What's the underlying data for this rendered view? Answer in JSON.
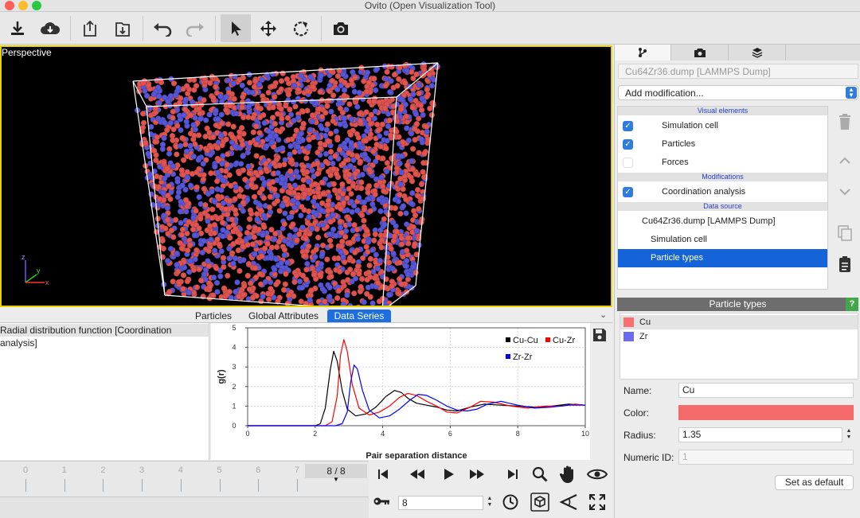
{
  "window": {
    "title": "Ovito (Open Visualization Tool)"
  },
  "toolbar": {
    "buttons": [
      "load-file-icon",
      "load-remote-icon",
      "export-icon",
      "export-image-icon",
      "undo-icon",
      "redo-icon",
      "select-mode-icon",
      "pan-icon",
      "orbit-icon",
      "render-icon"
    ]
  },
  "viewport": {
    "caption": "Perspective",
    "axes": {
      "z": "z",
      "y": "y",
      "x": "x"
    }
  },
  "pipeline": {
    "source_title": "Cu64Zr36.dump [LAMMPS Dump]",
    "add_modification": "Add modification...",
    "section_visual": "Visual elements",
    "visual_items": [
      {
        "label": "Simulation cell",
        "checked": true
      },
      {
        "label": "Particles",
        "checked": true
      },
      {
        "label": "Forces",
        "checked": false
      }
    ],
    "section_modifications": "Modifications",
    "modifications": [
      {
        "label": "Coordination analysis",
        "checked": true
      }
    ],
    "section_source": "Data source",
    "source_items": [
      "Cu64Zr36.dump [LAMMPS Dump]",
      "Simulation cell",
      "Particle types"
    ]
  },
  "particle_types": {
    "header": "Particle types",
    "help": "?",
    "types": [
      {
        "name": "Cu",
        "color": "#f87070"
      },
      {
        "name": "Zr",
        "color": "#6b6bf3"
      }
    ],
    "name_label": "Name:",
    "name_value": "Cu",
    "color_label": "Color:",
    "color_value": "#f56a6a",
    "radius_label": "Radius:",
    "radius_value": "1.35",
    "numeric_id_label": "Numeric ID:",
    "numeric_id_value": "1",
    "set_default": "Set as default"
  },
  "data_inspector": {
    "tabs": [
      "Particles",
      "Global Attributes",
      "Data Series"
    ],
    "selected_tab": "Data Series",
    "series_item": "Radial distribution function [Coordination analysis]"
  },
  "chart_data": {
    "type": "line",
    "title": "",
    "xlabel": "Pair separation distance",
    "ylabel": "g(r)",
    "xlim": [
      0,
      10
    ],
    "ylim": [
      0,
      5
    ],
    "xticks": [
      "0",
      "2",
      "4",
      "6",
      "8",
      "10"
    ],
    "yticks": [
      "0",
      "1",
      "2",
      "3",
      "4",
      "5"
    ],
    "legend_position": "top-right",
    "series": [
      {
        "name": "Cu-Cu",
        "color": "#000000",
        "x": [
          0,
          2.0,
          2.15,
          2.3,
          2.45,
          2.55,
          2.65,
          2.8,
          2.95,
          3.2,
          3.5,
          3.8,
          4.1,
          4.35,
          4.55,
          4.75,
          5.0,
          5.3,
          5.6,
          5.9,
          6.2,
          6.6,
          7.0,
          7.5,
          8.0,
          8.5,
          9.0,
          9.5,
          10.0
        ],
        "y": [
          0,
          0,
          0.1,
          0.9,
          2.9,
          3.8,
          3.3,
          1.8,
          0.85,
          0.5,
          0.6,
          0.95,
          1.5,
          1.8,
          1.7,
          1.4,
          1.15,
          1.05,
          0.95,
          0.8,
          0.75,
          0.95,
          1.1,
          1.05,
          1.0,
          0.95,
          1.0,
          1.1,
          1.05
        ]
      },
      {
        "name": "Cu-Zr",
        "color": "#ff0000",
        "x": [
          0,
          2.3,
          2.5,
          2.65,
          2.75,
          2.85,
          2.95,
          3.1,
          3.3,
          3.6,
          3.9,
          4.2,
          4.5,
          4.75,
          5.0,
          5.3,
          5.6,
          5.9,
          6.2,
          6.6,
          6.9,
          7.3,
          7.8,
          8.3,
          8.8,
          9.3,
          9.7,
          10.0
        ],
        "y": [
          0,
          0,
          0.2,
          1.5,
          3.6,
          4.4,
          3.8,
          2.1,
          0.9,
          0.55,
          0.7,
          1.0,
          1.45,
          1.65,
          1.55,
          1.25,
          1.0,
          0.7,
          0.65,
          0.95,
          1.25,
          1.2,
          1.0,
          0.9,
          1.0,
          1.0,
          1.1,
          1.05
        ]
      },
      {
        "name": "Zr-Zr",
        "color": "#0000ff",
        "x": [
          0,
          2.6,
          2.8,
          2.95,
          3.05,
          3.15,
          3.25,
          3.4,
          3.6,
          3.9,
          4.2,
          4.5,
          4.8,
          5.05,
          5.3,
          5.6,
          5.9,
          6.2,
          6.5,
          6.8,
          7.1,
          7.5,
          8.0,
          8.5,
          9.0,
          9.5,
          10.0
        ],
        "y": [
          0,
          0,
          0.1,
          0.7,
          2.2,
          3.1,
          2.9,
          1.8,
          0.8,
          0.4,
          0.5,
          0.85,
          1.3,
          1.6,
          1.55,
          1.3,
          1.0,
          0.8,
          0.75,
          0.85,
          1.1,
          1.25,
          1.05,
          0.9,
          0.95,
          1.05,
          1.05
        ]
      }
    ]
  },
  "timeline": {
    "ticks": [
      "0",
      "1",
      "2",
      "3",
      "4",
      "5",
      "6",
      "7"
    ],
    "frame_indicator": "8 / 8"
  },
  "animation": {
    "current_frame": "8"
  }
}
